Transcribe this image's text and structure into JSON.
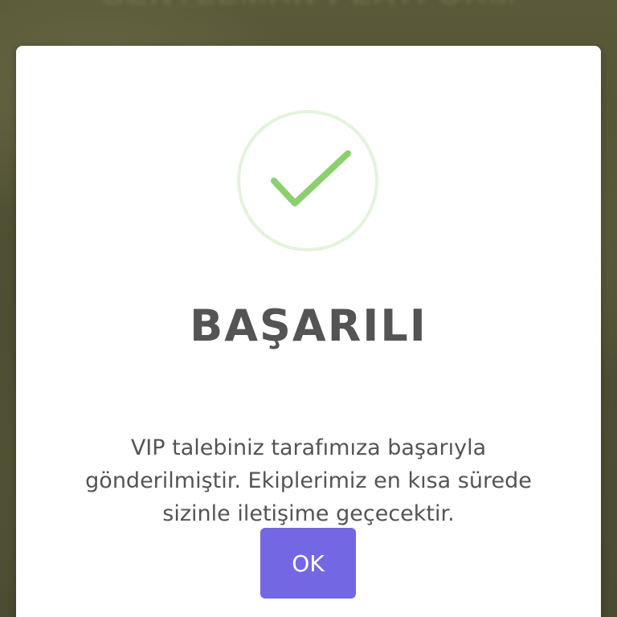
{
  "background": {
    "blurred_text": "GENTLEMAN PLATFORM"
  },
  "dialog": {
    "icon": "success-check-icon",
    "title": "BAŞARILI",
    "message": "VIP talebiniz tarafımıza başarıyla gönderilmiştir. Ekiplerimiz en kısa sürede sizinle iletişime geçecektir.",
    "ok_label": "OK"
  },
  "colors": {
    "accent": "#7367e4",
    "success": "#8ccf6f",
    "success_ring": "#e4f3dc",
    "text": "#545454"
  }
}
